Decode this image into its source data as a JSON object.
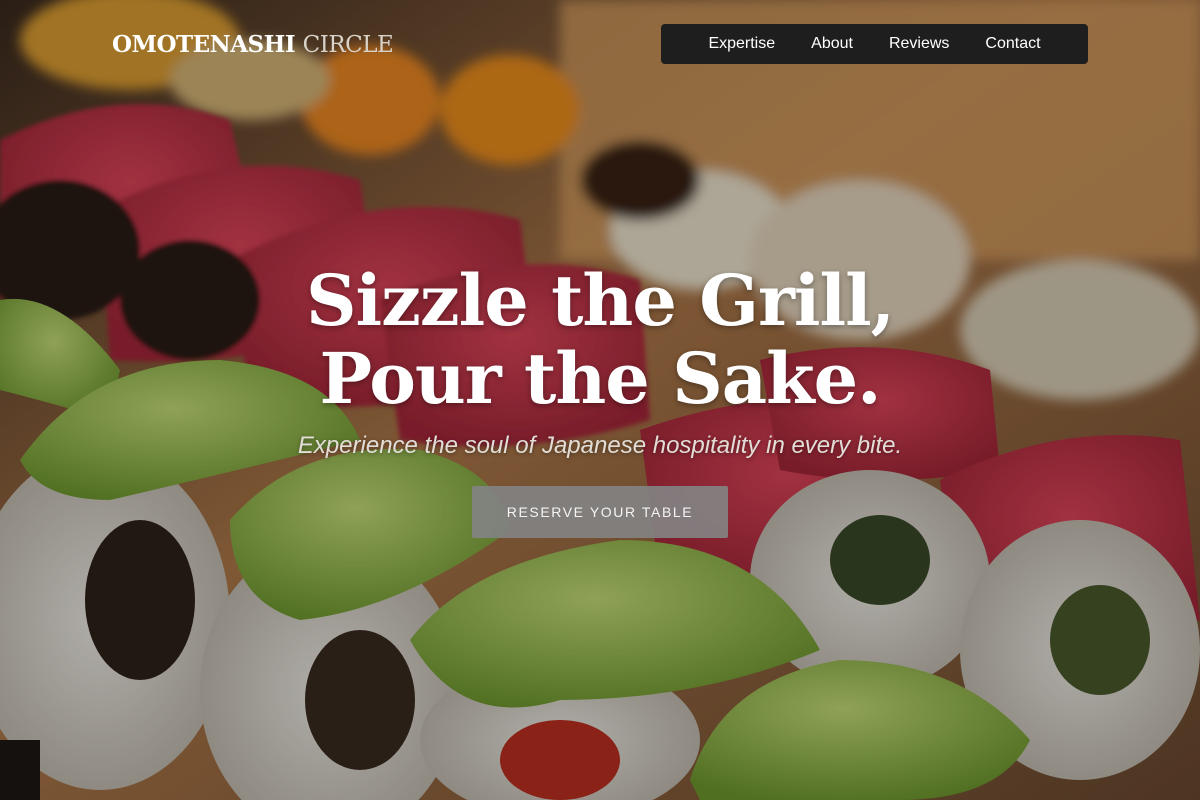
{
  "brand": {
    "name_primary": "OMOTENASHI",
    "name_secondary": "CIRCLE"
  },
  "nav": {
    "items": [
      {
        "label": "Expertise"
      },
      {
        "label": "About"
      },
      {
        "label": "Reviews"
      },
      {
        "label": "Contact"
      }
    ]
  },
  "hero": {
    "title_line1": "Sizzle the Grill,",
    "title_line2": "Pour the Sake.",
    "subtitle": "Experience the soul of Japanese hospitality in every bite.",
    "cta_label": "RESERVE YOUR TABLE",
    "background": "sushi-rolls-photo"
  },
  "colors": {
    "nav_background": "#1e1e1e",
    "cta_background": "#828282",
    "text": "#ffffff"
  }
}
